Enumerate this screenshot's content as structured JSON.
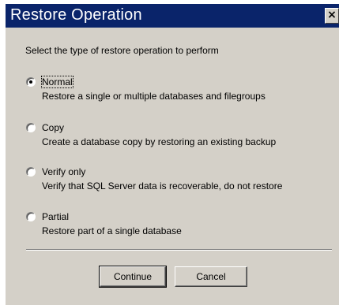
{
  "window": {
    "title": "Restore Operation",
    "close_glyph": "✕"
  },
  "instruction": "Select the type of restore operation to perform",
  "options": [
    {
      "label": "Normal",
      "description": "Restore a single or multiple databases and filegroups",
      "selected": true
    },
    {
      "label": "Copy",
      "description": "Create a database copy by restoring an existing backup",
      "selected": false
    },
    {
      "label": "Verify only",
      "description": "Verify that SQL Server data is recoverable, do not restore",
      "selected": false
    },
    {
      "label": "Partial",
      "description": "Restore part of a single database",
      "selected": false
    }
  ],
  "buttons": {
    "continue_label": "Continue",
    "cancel_label": "Cancel"
  },
  "colors": {
    "titlebar": "#0a246a",
    "dialog_bg": "#d4d0c8"
  }
}
